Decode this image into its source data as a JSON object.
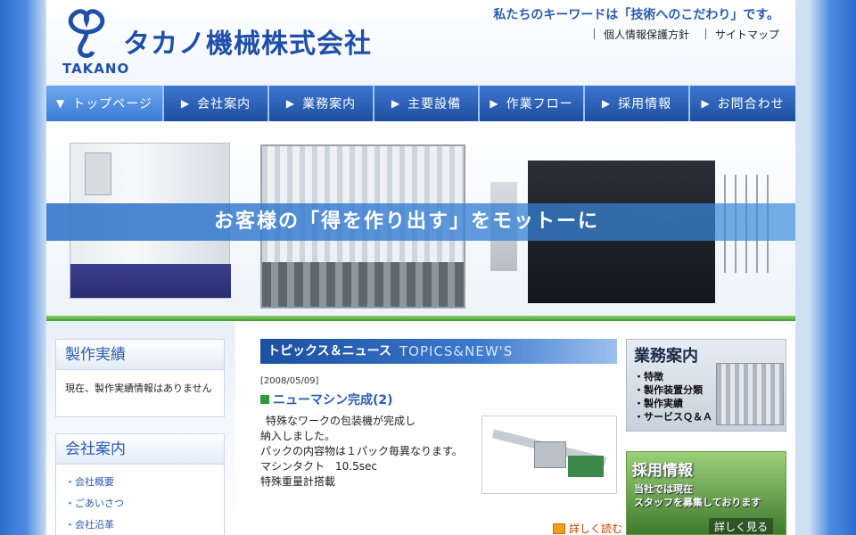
{
  "header": {
    "logo_text": "TAKANO",
    "company_name": "タカノ機械株式会社",
    "keyword": "私たちのキーワードは「技術へのこだわり」です。",
    "util_links": [
      "個人情報保護方針",
      "サイトマップ"
    ]
  },
  "nav": {
    "items": [
      {
        "label": "トップページ",
        "arrow": "▼"
      },
      {
        "label": "会社案内",
        "arrow": "▶"
      },
      {
        "label": "業務案内",
        "arrow": "▶"
      },
      {
        "label": "主要設備",
        "arrow": "▶"
      },
      {
        "label": "作業フロー",
        "arrow": "▶"
      },
      {
        "label": "採用情報",
        "arrow": "▶"
      },
      {
        "label": "お問合わせ",
        "arrow": "▶"
      }
    ]
  },
  "hero": {
    "slogan": "お客様の「得を作り出す」をモットーに"
  },
  "sidebar": {
    "achievements": {
      "title": "製作実績",
      "text": "現在、製作実績情報はありません"
    },
    "company": {
      "title": "会社案内",
      "items": [
        "・会社概要",
        "・ごあいさつ",
        "・会社沿革"
      ]
    }
  },
  "news": {
    "heading_ja": "トピックス＆ニュース",
    "heading_en": "TOPICS&NEW'S",
    "date": "[2008/05/09]",
    "title": "ニューマシン完成(2)",
    "body": [
      "特殊なワークの包装機が完成し",
      "納入しました。",
      "パックの内容物は１パック毎異なります。",
      "マシンタクト　10.5sec",
      "特殊重量計搭載"
    ],
    "read_more": "詳しく読む"
  },
  "banners": {
    "business": {
      "title": "業務案内",
      "items": [
        "・特徴",
        "・製作装置分類",
        "・製作実績",
        "・サービスＱ＆Ａ"
      ]
    },
    "recruit": {
      "title": "採用情報",
      "subtitle_lines": [
        "当社では現在",
        "スタッフを募集しております"
      ],
      "button": "詳しく見る"
    }
  },
  "colors": {
    "brand_blue": "#2a5cb0",
    "nav_blue": "#1e4e9f",
    "accent_green": "#2e9a3a"
  }
}
